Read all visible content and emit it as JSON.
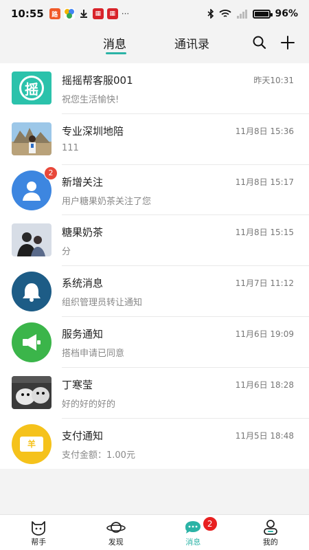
{
  "statusbar": {
    "time": "10:55",
    "battery": "96%",
    "battery_level": 0.96
  },
  "tabs": {
    "messages": "消息",
    "contacts": "通讯录"
  },
  "conversations": [
    {
      "title": "摇摇帮客服001",
      "time": "昨天10:31",
      "preview": "祝您生活愉快!",
      "avatar": "logo",
      "avatar_text": "摇"
    },
    {
      "title": "专业深圳地陪",
      "time": "11月8日 15:36",
      "preview": "111",
      "avatar": "photo"
    },
    {
      "title": "新增关注",
      "time": "11月8日 15:17",
      "preview": "用户糖果奶茶关注了您",
      "avatar": "user",
      "badge": "2"
    },
    {
      "title": "糖果奶茶",
      "time": "11月8日 15:15",
      "preview": "分",
      "avatar": "photo2"
    },
    {
      "title": "系统消息",
      "time": "11月7日 11:12",
      "preview": "组织管理员转让通知",
      "avatar": "bell"
    },
    {
      "title": "服务通知",
      "time": "11月6日 19:09",
      "preview": "搭档申请已同意",
      "avatar": "speaker"
    },
    {
      "title": "丁寒莹",
      "time": "11月6日 18:28",
      "preview": "好的好的好的",
      "avatar": "photo3"
    },
    {
      "title": "支付通知",
      "time": "11月5日 18:48",
      "preview": "支付金额：1.00元",
      "avatar": "money",
      "avatar_text": "羊"
    }
  ],
  "nav": {
    "helper": "帮手",
    "discover": "发现",
    "messages": "消息",
    "messages_badge": "2",
    "mine": "我的"
  },
  "colors": {
    "accent": "#2bb3a6",
    "badge": "#e8483a"
  }
}
